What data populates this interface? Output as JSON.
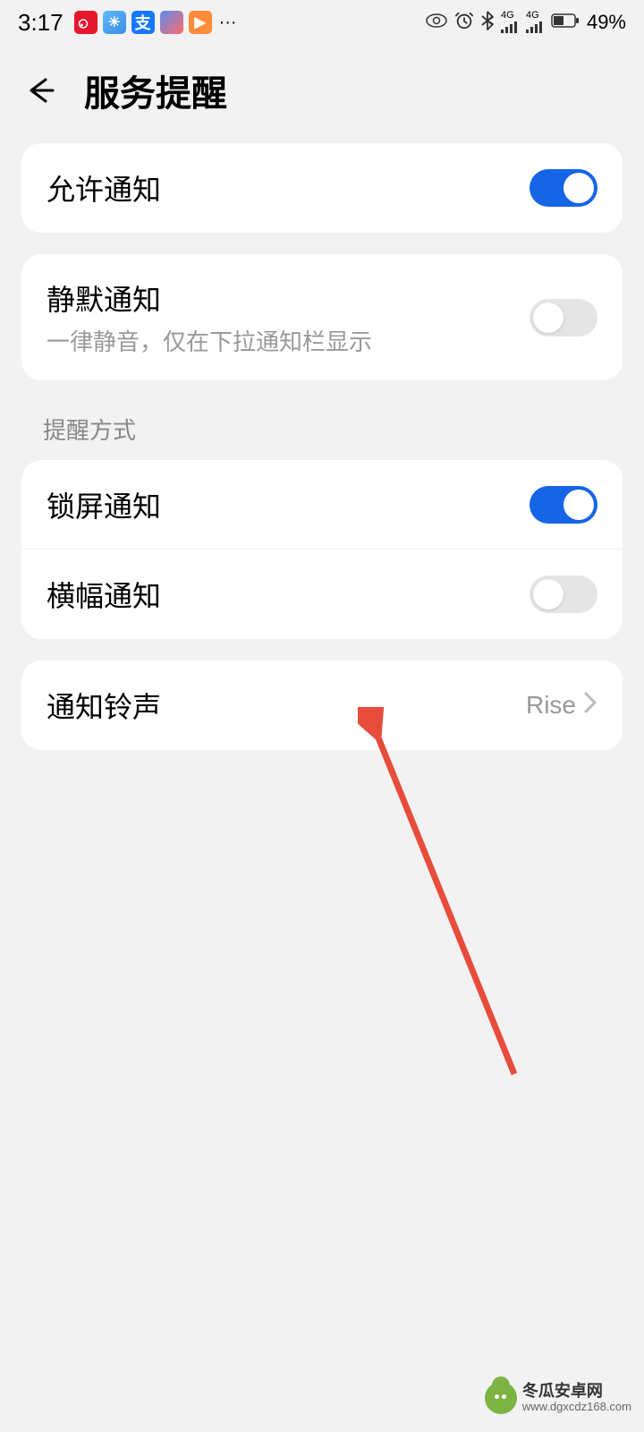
{
  "status_bar": {
    "time": "3:17",
    "battery": "49%",
    "more": "···"
  },
  "header": {
    "title": "服务提醒"
  },
  "allow_notifications": {
    "label": "允许通知"
  },
  "silent_notifications": {
    "label": "静默通知",
    "subtitle": "一律静音，仅在下拉通知栏显示"
  },
  "section": {
    "title": "提醒方式"
  },
  "lock_screen": {
    "label": "锁屏通知"
  },
  "banner": {
    "label": "横幅通知"
  },
  "sound": {
    "label": "通知铃声",
    "value": "Rise"
  },
  "watermark": {
    "title": "冬瓜安卓网",
    "url": "www.dgxcdz168.com"
  }
}
